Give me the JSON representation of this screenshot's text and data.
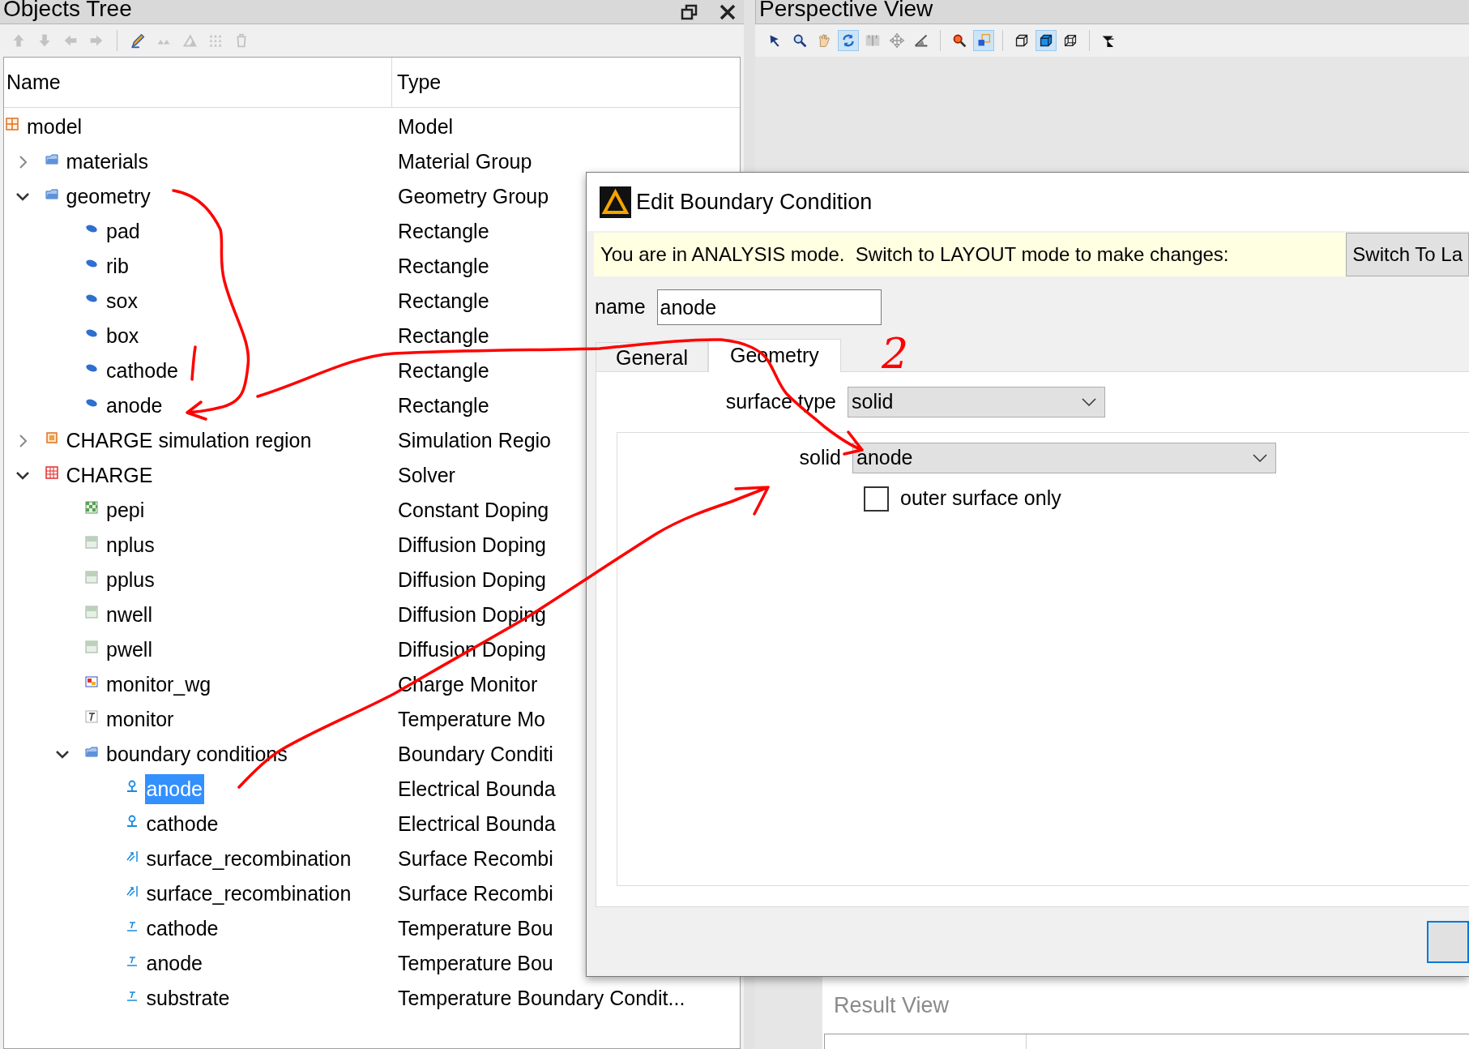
{
  "objects_tree": {
    "title": "Objects Tree",
    "tools": [
      {
        "kind": "up",
        "disabled": true
      },
      {
        "kind": "down",
        "disabled": true
      },
      {
        "kind": "left",
        "disabled": true
      },
      {
        "kind": "right",
        "disabled": true
      },
      {
        "kind": "sep"
      },
      {
        "kind": "edit",
        "disabled": false
      },
      {
        "kind": "small_triangles",
        "disabled": true
      },
      {
        "kind": "triangle",
        "disabled": true
      },
      {
        "kind": "triangle_grid",
        "disabled": true
      },
      {
        "kind": "trash",
        "disabled": true
      }
    ],
    "columns": [
      "Name",
      "Type"
    ],
    "rows": [
      {
        "name": "model",
        "type": "Model",
        "kind": "model",
        "selected": false,
        "children": [
          {
            "name": "materials",
            "type": "Material Group",
            "kind": "group",
            "expanded": false,
            "selected": false
          },
          {
            "name": "geometry",
            "type": "Geometry Group",
            "kind": "group",
            "expanded": true,
            "selected": false,
            "children": [
              {
                "name": "pad",
                "type": "Rectangle",
                "kind": "rectangle",
                "selected": false
              },
              {
                "name": "rib",
                "type": "Rectangle",
                "kind": "rectangle",
                "selected": false
              },
              {
                "name": "sox",
                "type": "Rectangle",
                "kind": "rectangle",
                "selected": false
              },
              {
                "name": "box",
                "type": "Rectangle",
                "kind": "rectangle",
                "selected": false
              },
              {
                "name": "cathode",
                "type": "Rectangle",
                "kind": "rectangle",
                "selected": false
              },
              {
                "name": "anode",
                "type": "Rectangle",
                "kind": "rectangle",
                "selected": false
              }
            ]
          },
          {
            "name": "CHARGE simulation region",
            "type": "Simulation Regio",
            "kind": "region",
            "expanded": false,
            "selected": false
          },
          {
            "name": "CHARGE",
            "type": "Solver",
            "kind": "solver",
            "expanded": true,
            "selected": false,
            "children": [
              {
                "name": "pepi",
                "type": "Constant Doping",
                "kind": "constant_doping",
                "selected": false
              },
              {
                "name": "nplus",
                "type": "Diffusion Doping",
                "kind": "diffusion_doping",
                "selected": false
              },
              {
                "name": "pplus",
                "type": "Diffusion Doping",
                "kind": "diffusion_doping",
                "selected": false
              },
              {
                "name": "nwell",
                "type": "Diffusion Doping",
                "kind": "diffusion_doping",
                "selected": false
              },
              {
                "name": "pwell",
                "type": "Diffusion Doping",
                "kind": "diffusion_doping",
                "selected": false
              },
              {
                "name": "monitor_wg",
                "type": "Charge Monitor",
                "kind": "charge_monitor",
                "selected": false
              },
              {
                "name": "monitor",
                "type": "Temperature Mo",
                "kind": "temperature_monitor",
                "selected": false
              },
              {
                "name": "boundary conditions",
                "type": "Boundary Conditi",
                "kind": "group",
                "expanded": true,
                "selected": false,
                "children": [
                  {
                    "name": "anode",
                    "type": "Electrical Bounda",
                    "kind": "electrical_bc",
                    "selected": true
                  },
                  {
                    "name": "cathode",
                    "type": "Electrical Bounda",
                    "kind": "electrical_bc",
                    "selected": false
                  },
                  {
                    "name": "surface_recombination",
                    "type": "Surface Recombi",
                    "kind": "recombination_bc",
                    "selected": false
                  },
                  {
                    "name": "surface_recombination",
                    "type": "Surface Recombi",
                    "kind": "recombination_bc",
                    "selected": false
                  },
                  {
                    "name": "cathode",
                    "type": "Temperature Bou",
                    "kind": "thermal_bc",
                    "selected": false
                  },
                  {
                    "name": "anode",
                    "type": "Temperature Bou",
                    "kind": "thermal_bc",
                    "selected": false
                  },
                  {
                    "name": "substrate",
                    "type": "Temperature Boundary Condit...",
                    "kind": "thermal_bc",
                    "selected": false
                  }
                ]
              }
            ]
          }
        ]
      }
    ]
  },
  "perspective_view": {
    "title": "Perspective View",
    "tools": [
      {
        "kind": "select",
        "on": false
      },
      {
        "kind": "zoom",
        "on": false
      },
      {
        "kind": "pan",
        "on": false
      },
      {
        "kind": "rotate",
        "on": true
      },
      {
        "kind": "ruler",
        "on": false
      },
      {
        "kind": "move",
        "on": false
      },
      {
        "kind": "angle",
        "on": false
      },
      {
        "kind": "sep"
      },
      {
        "kind": "zoom_extent",
        "on": false
      },
      {
        "kind": "region",
        "on": true
      },
      {
        "kind": "sep"
      },
      {
        "kind": "cube",
        "on": false
      },
      {
        "kind": "solid_cube",
        "on": true
      },
      {
        "kind": "wire_cube",
        "on": false
      },
      {
        "kind": "sep"
      },
      {
        "kind": "filter",
        "on": false
      }
    ]
  },
  "dialog": {
    "title": "Edit Boundary Condition",
    "notice": "You are in ANALYSIS mode.  Switch to LAYOUT mode to make changes:",
    "switch_button": "Switch To La",
    "name_label": "name",
    "name_value": "anode",
    "tabs": [
      {
        "label": "General",
        "selected": false
      },
      {
        "label": "Geometry",
        "selected": true
      }
    ],
    "surface_type": {
      "label": "surface type",
      "value": "solid"
    },
    "solid": {
      "label": "solid",
      "value": "anode"
    },
    "outer_surface_only": {
      "label": "outer surface only",
      "checked": false
    }
  },
  "result_view": {
    "title": "Result View"
  },
  "annotation_label": "2"
}
